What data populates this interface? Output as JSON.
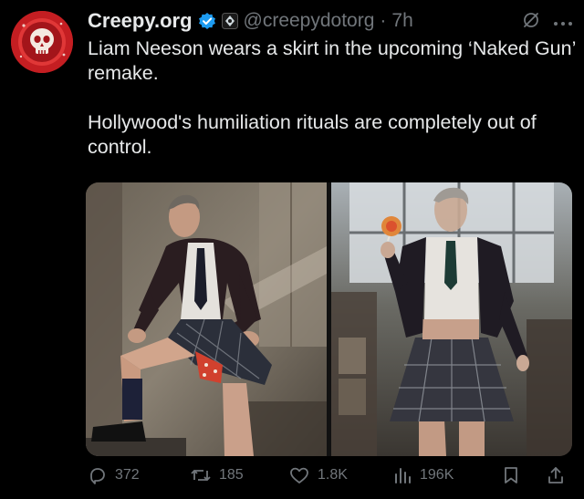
{
  "author": {
    "display_name": "Creepy.org",
    "handle": "@creepydotorg",
    "separator": "·",
    "time_ago": "7h",
    "avatar_icon": "skull-gear-logo",
    "verified_color": "#1d9bf0"
  },
  "tweet": {
    "line1": "Liam Neeson wears a skirt in the upcoming ‘Naked Gun’ remake.",
    "line2": "Hollywood's humiliation rituals are completely out of control."
  },
  "media": {
    "images": [
      {
        "icon": "photo-man-in-cardigan-and-plaid-skirt-standing"
      },
      {
        "icon": "photo-man-in-plaid-skirt-holding-lollipop"
      }
    ]
  },
  "actions": {
    "replies": "372",
    "reposts": "185",
    "likes": "1.8K",
    "views": "196K"
  },
  "colors": {
    "background": "#000000",
    "text": "#e7e9ea",
    "muted": "#71767b",
    "accent": "#1d9bf0",
    "avatar_red": "#c41e22"
  }
}
